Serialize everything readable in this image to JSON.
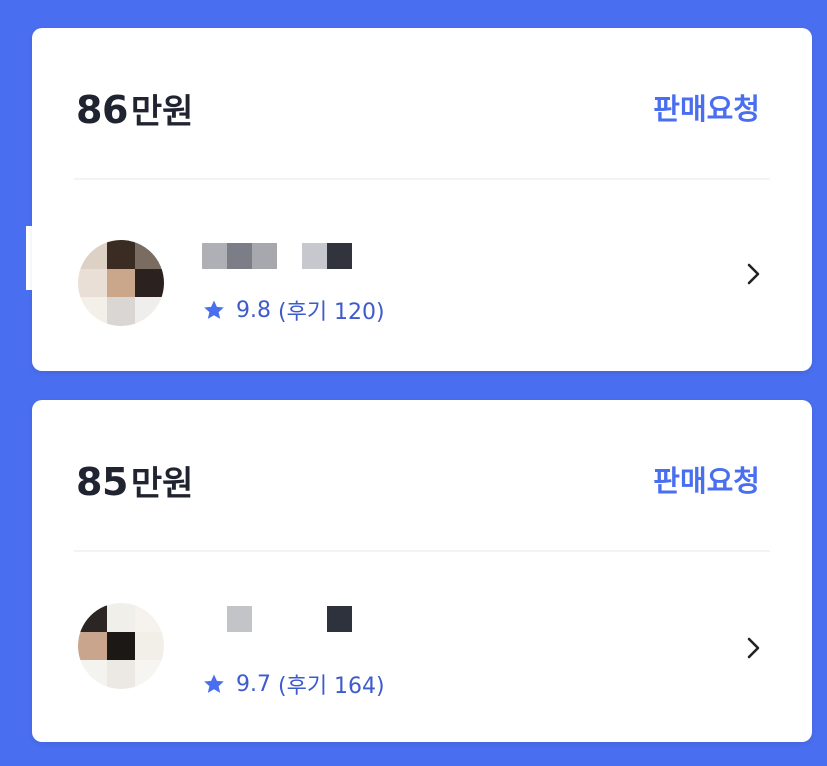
{
  "offers": [
    {
      "price": "86",
      "unit": "만원",
      "action_label": "판매요청",
      "rating_value": "9.8",
      "review_label": "(후기 120)",
      "icons": {
        "star": "star-icon",
        "chevron": "chevron-right-icon"
      },
      "avatar_colors": [
        "#ddd1c6",
        "#3a2c22",
        "#7a6c60",
        "#eadfd6",
        "#caa68a",
        "#2b2220",
        "#f3efe9",
        "#d9d6d3",
        "#f0eeec"
      ],
      "name_colors": [
        "#aeb0b5",
        "#7b7e86",
        "#a6a8ad",
        "#ffffff",
        "#c6c8cd",
        "#31343c"
      ]
    },
    {
      "price": "85",
      "unit": "만원",
      "action_label": "판매요청",
      "rating_value": "9.7",
      "review_label": "(후기 164)",
      "icons": {
        "star": "star-icon",
        "chevron": "chevron-right-icon"
      },
      "avatar_colors": [
        "#2b2523",
        "#f0efe9",
        "#f6f3ee",
        "#c9a58d",
        "#1c1816",
        "#f2eee8",
        "#f5f3ef",
        "#ece9e4",
        "#f7f5f2"
      ],
      "name_colors": [
        "#ffffff",
        "#c3c4c7",
        "#ffffff",
        "#ffffff",
        "#ffffff",
        "#2d323c"
      ]
    }
  ],
  "colors": {
    "background": "#4a6ef0",
    "accent": "#4a6ef0",
    "rating": "#3e5bcc"
  }
}
